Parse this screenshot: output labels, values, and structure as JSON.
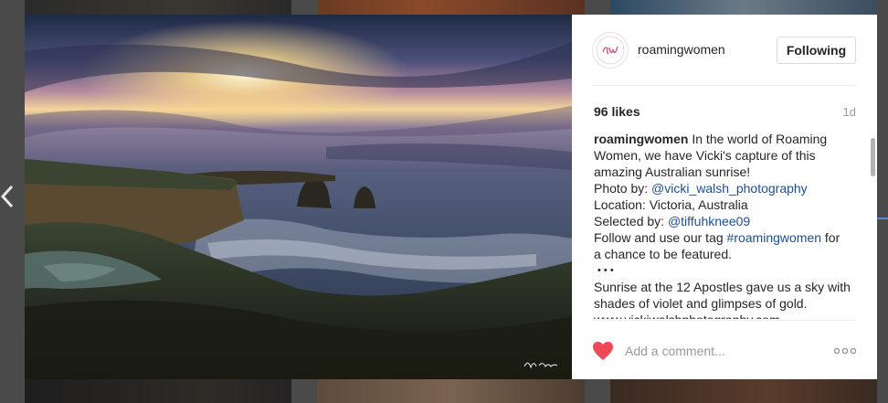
{
  "post": {
    "username": "roamingwomen",
    "avatar_initials": "rw",
    "follow_label": "Following",
    "likes": "96 likes",
    "time_ago": "1d",
    "caption": {
      "author": "roamingwomen",
      "line1": " In the world of Roaming",
      "line2": "Women, we have Vicki's capture of this",
      "line3": "amazing Australian sunrise!",
      "photo_by_label": "Photo by: ",
      "photo_by_handle": "@vicki_walsh_photography",
      "location": "Location: Victoria, Australia",
      "selected_by_label": "Selected by: ",
      "selected_by_handle": "@tiffuhknee09",
      "follow_prefix": "Follow and use our tag ",
      "hashtag": "#roamingwomen",
      "follow_suffix": " for",
      "follow_line2": "a chance to be featured.",
      "dots": "• • •",
      "story": "Sunrise at the 12 Apostles gave us a sky with shades of violet and glimpses of gold.",
      "cutoff": "www.vickiwalshphotography.com"
    },
    "comment_placeholder": "Add a comment..."
  },
  "colors": {
    "accent_link": "#1d4f8f",
    "heart": "#ed4956",
    "text": "#262626",
    "muted": "#999999"
  },
  "icons": {
    "prev": "chevron-left-icon",
    "like": "heart-icon",
    "more": "more-options-icon"
  }
}
